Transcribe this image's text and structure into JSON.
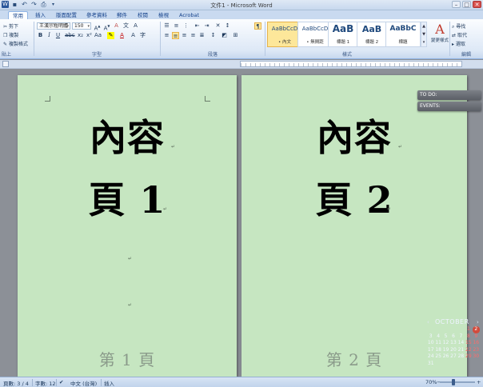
{
  "window": {
    "title": "文件1 - Microsoft Word",
    "qat_icons": [
      "word-logo-icon",
      "save-icon",
      "undo-icon",
      "redo-icon",
      "print-icon",
      "customize-icon"
    ],
    "controls": {
      "minimize": "–",
      "maximize": "□",
      "close": "✕"
    }
  },
  "tabs": [
    {
      "label": "常用",
      "active": true
    },
    {
      "label": "插入"
    },
    {
      "label": "版面配置"
    },
    {
      "label": "參考資料"
    },
    {
      "label": "郵件"
    },
    {
      "label": "校閱"
    },
    {
      "label": "檢視"
    },
    {
      "label": "Acrobat"
    }
  ],
  "ribbon": {
    "clipboard": {
      "cut": "剪下",
      "copy": "複製",
      "format_painter": "複製格式",
      "paste": "貼上",
      "label": "剪貼簿"
    },
    "font": {
      "name": "王漢宗粗明體",
      "size": "150",
      "label": "字型"
    },
    "paragraph": {
      "label": "段落"
    },
    "styles": {
      "label": "樣式",
      "items": [
        {
          "sample": "AaBbCcD",
          "name": "• 內文",
          "active": true
        },
        {
          "sample": "AaBbCcD",
          "name": "• 無間距"
        },
        {
          "sample": "AaB",
          "name": "標題 1"
        },
        {
          "sample": "AaB",
          "name": "標題 2"
        },
        {
          "sample": "AaBbC",
          "name": "標題"
        }
      ],
      "change_styles": "變更樣式"
    },
    "editing": {
      "find": "尋找",
      "replace": "取代",
      "select": "選取",
      "label": "編輯"
    }
  },
  "pages": [
    {
      "line1": "內容",
      "line2": "頁 1",
      "footer": "第 1 頁"
    },
    {
      "line1": "內容",
      "line2": "頁 2",
      "footer": "第 2 頁"
    }
  ],
  "gadgets": {
    "todo": "TO DO:",
    "events": "EVENTS:",
    "calendar": {
      "month": "OCTOBER",
      "days": [
        "",
        "",
        "",
        "",
        "",
        "1",
        "2",
        "3",
        "4",
        "5",
        "6",
        "7",
        "8",
        "9",
        "10",
        "11",
        "12",
        "13",
        "14",
        "15",
        "16",
        "17",
        "18",
        "19",
        "20",
        "21",
        "22",
        "23",
        "24",
        "25",
        "26",
        "27",
        "28",
        "29",
        "30",
        "31",
        "",
        "",
        "",
        "",
        "",
        ""
      ]
    }
  },
  "statusbar": {
    "page": "頁數: 3 / 4",
    "words": "字數: 12",
    "language": "中文 (台灣)",
    "mode": "插入",
    "zoom": "70%"
  }
}
